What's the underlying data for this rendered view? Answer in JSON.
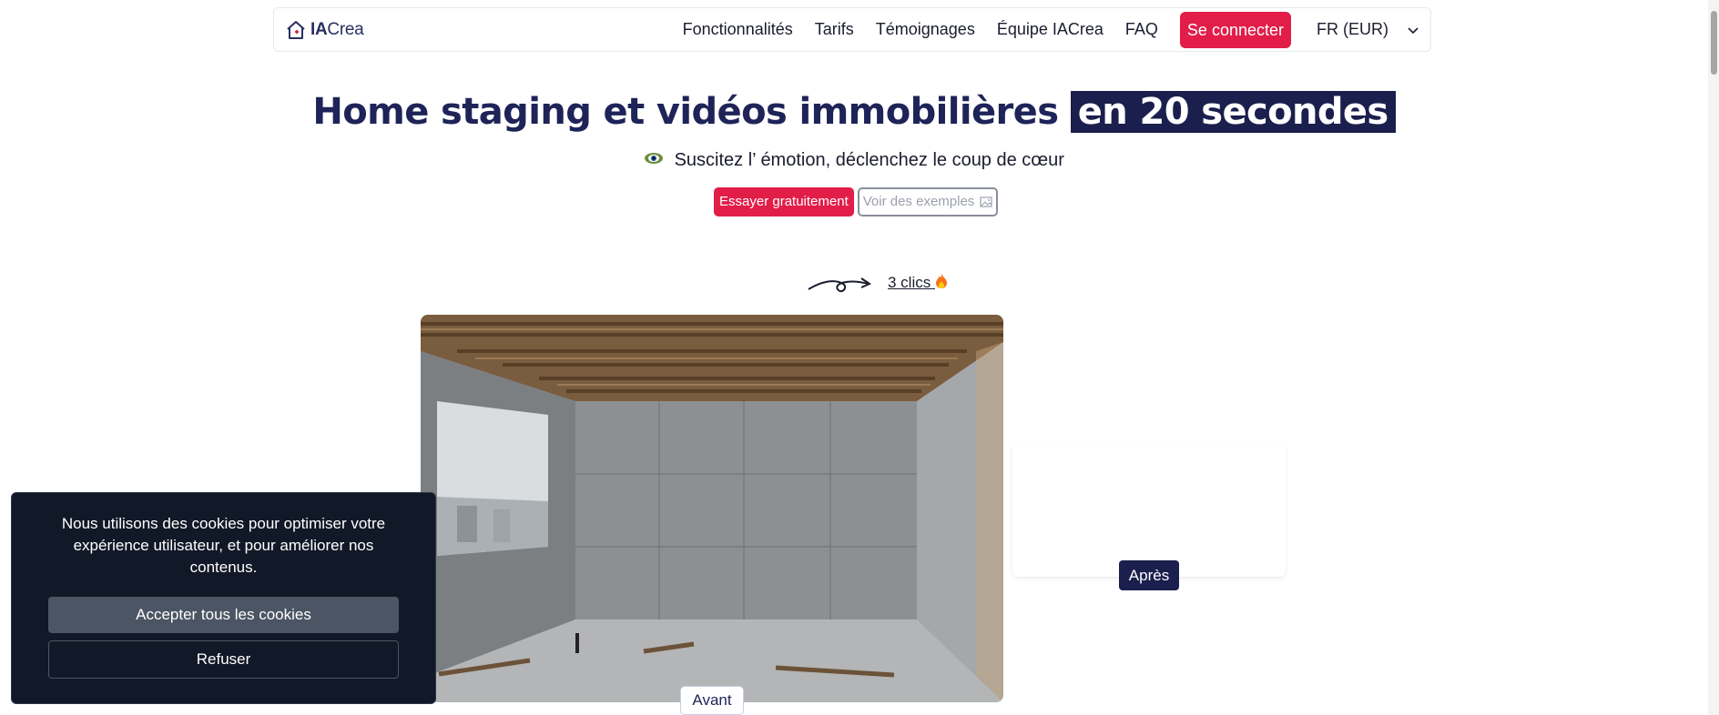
{
  "brand": {
    "logo_bold": "IA",
    "logo_rest": "Crea"
  },
  "nav": {
    "links": [
      "Fonctionnalités",
      "Tarifs",
      "Témoignages",
      "Équipe IACrea",
      "FAQ"
    ],
    "login": "Se connecter",
    "language": "FR (EUR)"
  },
  "hero": {
    "title_main": "Home staging et vidéos immobilières",
    "title_highlight": "en 20 secondes",
    "subtitle": "Suscitez l’ émotion, déclenchez le coup de cœur",
    "cta_primary": "Essayer gratuitement",
    "cta_secondary": "Voir des exemples"
  },
  "demo": {
    "note": "3 clics",
    "before_label": "Avant",
    "after_label": "Après"
  },
  "cookie": {
    "message": "Nous utilisons des cookies pour optimiser votre expérience utilisateur, et pour améliorer nos contenus.",
    "accept": "Accepter tous les cookies",
    "refuse": "Refuser"
  },
  "colors": {
    "accent": "#e11d48",
    "navy": "#1b1f4d",
    "cookie_bg": "#111827"
  },
  "icons": {
    "logo": "house-icon",
    "language": "chevron-down-icon",
    "examples": "image-icon",
    "subtitle": "eye-emoji-icon",
    "note": "fire-icon"
  }
}
